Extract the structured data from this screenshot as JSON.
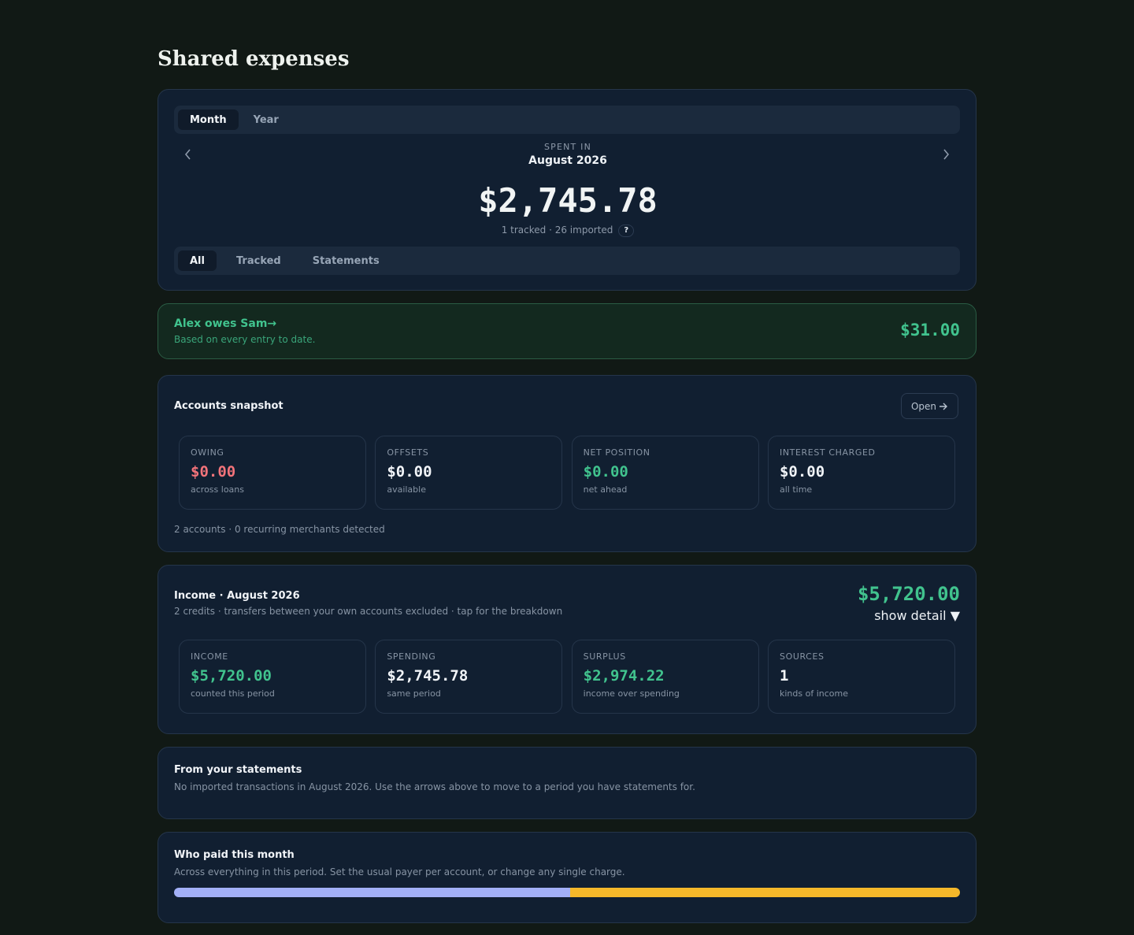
{
  "page": {
    "title": "Shared expenses"
  },
  "summary": {
    "period_tabs": [
      "Month",
      "Year"
    ],
    "active_period_tab": "Month",
    "spent_in_label": "SPENT IN",
    "period": "August 2026",
    "total": "$2,745.78",
    "counts": "1 tracked · 26 imported",
    "help": "?",
    "prev_icon": "chevron-left-icon",
    "next_icon": "chevron-right-icon",
    "filter_tabs": [
      "All",
      "Tracked",
      "Statements"
    ],
    "active_filter_tab": "All"
  },
  "settlement": {
    "title": "Alex owes Sam",
    "arrow": "→",
    "subtitle": "Based on every entry to date.",
    "amount": "$31.00",
    "color": "#41c38e"
  },
  "accounts": {
    "title": "Accounts snapshot",
    "open_label": "Open",
    "tiles": [
      {
        "label": "OWING",
        "value": "$0.00",
        "note": "across loans",
        "tone": "red"
      },
      {
        "label": "OFFSETS",
        "value": "$0.00",
        "note": "available",
        "tone": ""
      },
      {
        "label": "NET POSITION",
        "value": "$0.00",
        "note": "net ahead",
        "tone": "green"
      },
      {
        "label": "INTEREST CHARGED",
        "value": "$0.00",
        "note": "all time",
        "tone": ""
      }
    ],
    "footer": "2 accounts · 0 recurring merchants detected"
  },
  "income": {
    "title": "Income · August 2026",
    "subtitle": "2 credits · transfers between your own accounts excluded · tap for the breakdown",
    "amount": "$5,720.00",
    "show_detail": "show detail ▼",
    "tiles": [
      {
        "label": "INCOME",
        "value": "$5,720.00",
        "note": "counted this period",
        "tone": "green"
      },
      {
        "label": "SPENDING",
        "value": "$2,745.78",
        "note": "same period",
        "tone": ""
      },
      {
        "label": "SURPLUS",
        "value": "$2,974.22",
        "note": "income over spending",
        "tone": "green"
      },
      {
        "label": "SOURCES",
        "value": "1",
        "note": "kinds of income",
        "tone": ""
      }
    ]
  },
  "statements": {
    "title": "From your statements",
    "subtitle": "No imported transactions in August 2026. Use the arrows above to move to a period you have statements for."
  },
  "who_paid": {
    "title": "Who paid this month",
    "subtitle": "Across everything in this period. Set the usual payer per account, or change any single charge.",
    "share_a": 0.504,
    "color_a": "#a3b0f7",
    "color_b": "#f5b82a"
  }
}
